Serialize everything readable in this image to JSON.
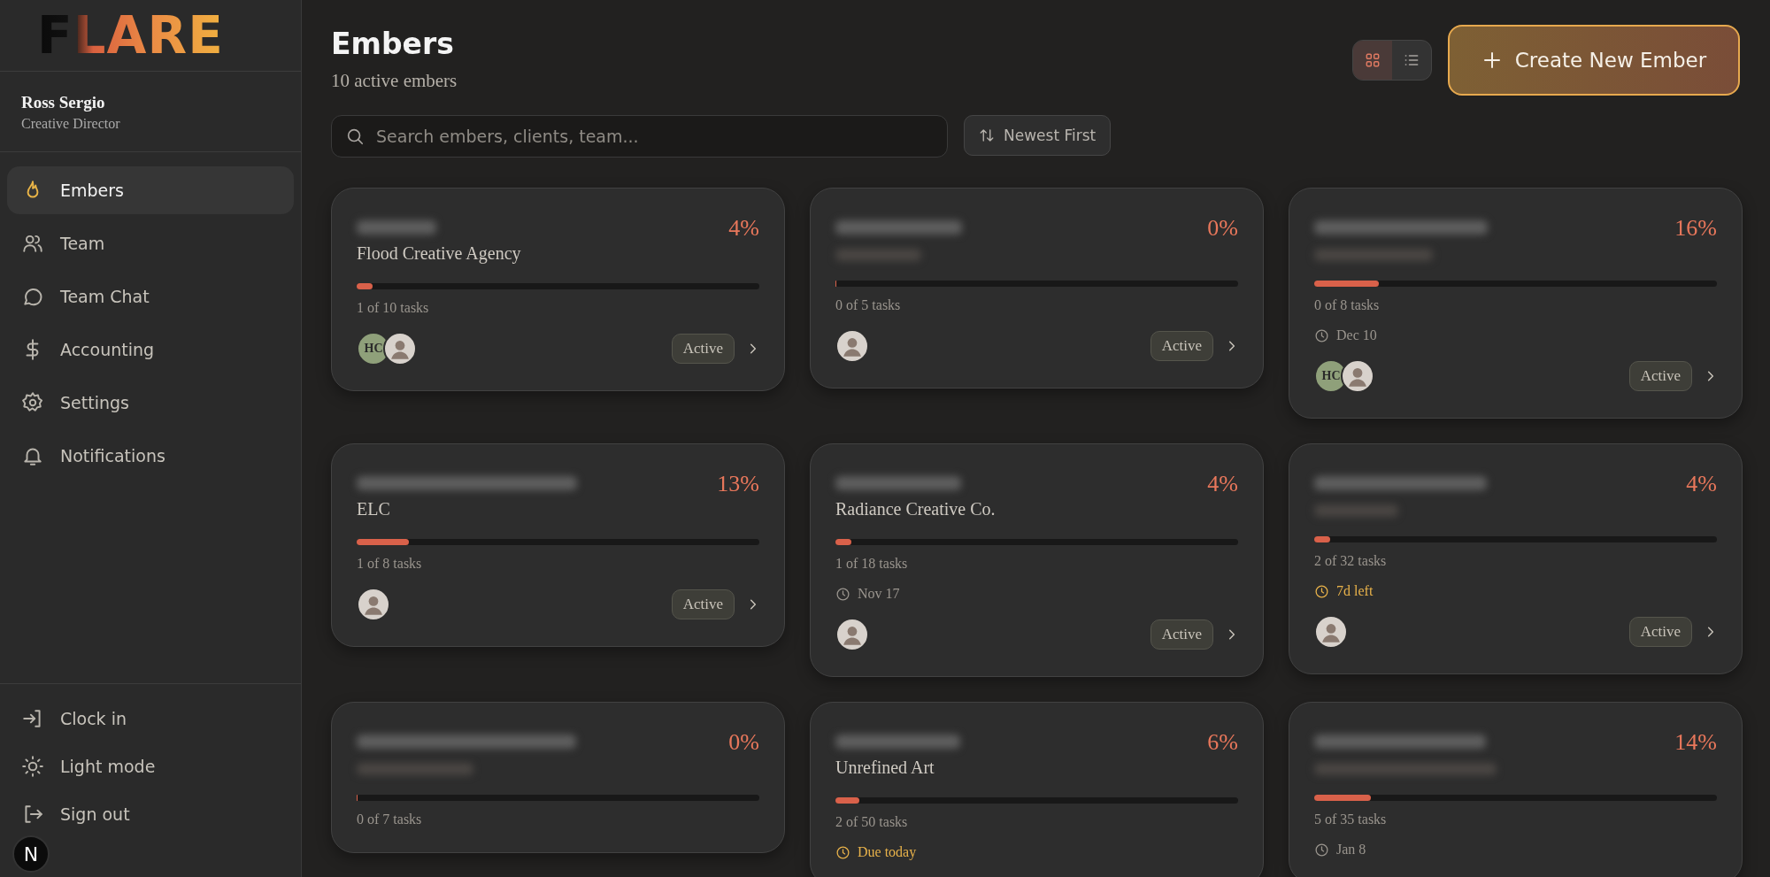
{
  "brand": {
    "logo": "FLARE"
  },
  "user": {
    "name": "Ross Sergio",
    "role": "Creative Director"
  },
  "nav": [
    {
      "label": "Embers",
      "selected": true
    },
    {
      "label": "Team",
      "selected": false
    },
    {
      "label": "Team Chat",
      "selected": false
    },
    {
      "label": "Accounting",
      "selected": false
    },
    {
      "label": "Settings",
      "selected": false
    },
    {
      "label": "Notifications",
      "selected": false
    }
  ],
  "footer_nav": [
    {
      "label": "Clock in"
    },
    {
      "label": "Light mode"
    },
    {
      "label": "Sign out"
    }
  ],
  "dev_badge": "N",
  "header": {
    "title": "Embers",
    "subtitle": "10 active embers",
    "create_button": "Create New Ember"
  },
  "view_toggle": [
    {
      "selected": true
    },
    {
      "selected": false
    }
  ],
  "search": {
    "placeholder": "Search embers, clients, team..."
  },
  "sort": {
    "label": "Newest First"
  },
  "cards": [
    {
      "percent": "4%",
      "level": 0.04,
      "client": "Flood Creative Agency",
      "tasks": "1 of 10 tasks",
      "members": [
        {
          "kind": "initials",
          "initials": "HC"
        },
        {
          "kind": "photo"
        }
      ],
      "status": "Active"
    },
    {
      "percent": "0%",
      "level": 0,
      "tasks": "0 of 5 tasks",
      "members": [
        {
          "kind": "photo"
        }
      ],
      "status": "Active"
    },
    {
      "percent": "16%",
      "level": 0.16,
      "tasks": "0 of 8 tasks",
      "due": {
        "kind": "date",
        "text": "Dec 10"
      },
      "members": [
        {
          "kind": "initials",
          "initials": "HC"
        },
        {
          "kind": "photo"
        }
      ],
      "status": "Active"
    },
    {
      "percent": "13%",
      "level": 0.13,
      "client": "ELC",
      "tasks": "1 of 8 tasks",
      "members": [
        {
          "kind": "photo"
        }
      ],
      "status": "Active"
    },
    {
      "percent": "4%",
      "level": 0.04,
      "client": "Radiance Creative Co.",
      "tasks": "1 of 18 tasks",
      "due": {
        "kind": "date",
        "text": "Nov 17"
      },
      "members": [
        {
          "kind": "photo"
        }
      ],
      "status": "Active"
    },
    {
      "percent": "4%",
      "level": 0.04,
      "tasks": "2 of 32 tasks",
      "due": {
        "kind": "warning",
        "text": "7d left"
      },
      "members": [
        {
          "kind": "photo"
        }
      ],
      "status": "Active"
    },
    {
      "percent": "0%",
      "level": 0,
      "tasks": "0 of 7 tasks"
    },
    {
      "percent": "6%",
      "level": 0.06,
      "client": "Unrefined Art",
      "tasks": "2 of 50 tasks",
      "due": {
        "kind": "warning",
        "text": "Due today"
      }
    },
    {
      "percent": "14%",
      "level": 0.14,
      "tasks": "5 of 35 tasks",
      "due": {
        "kind": "date",
        "text": "Jan 8"
      }
    }
  ]
}
